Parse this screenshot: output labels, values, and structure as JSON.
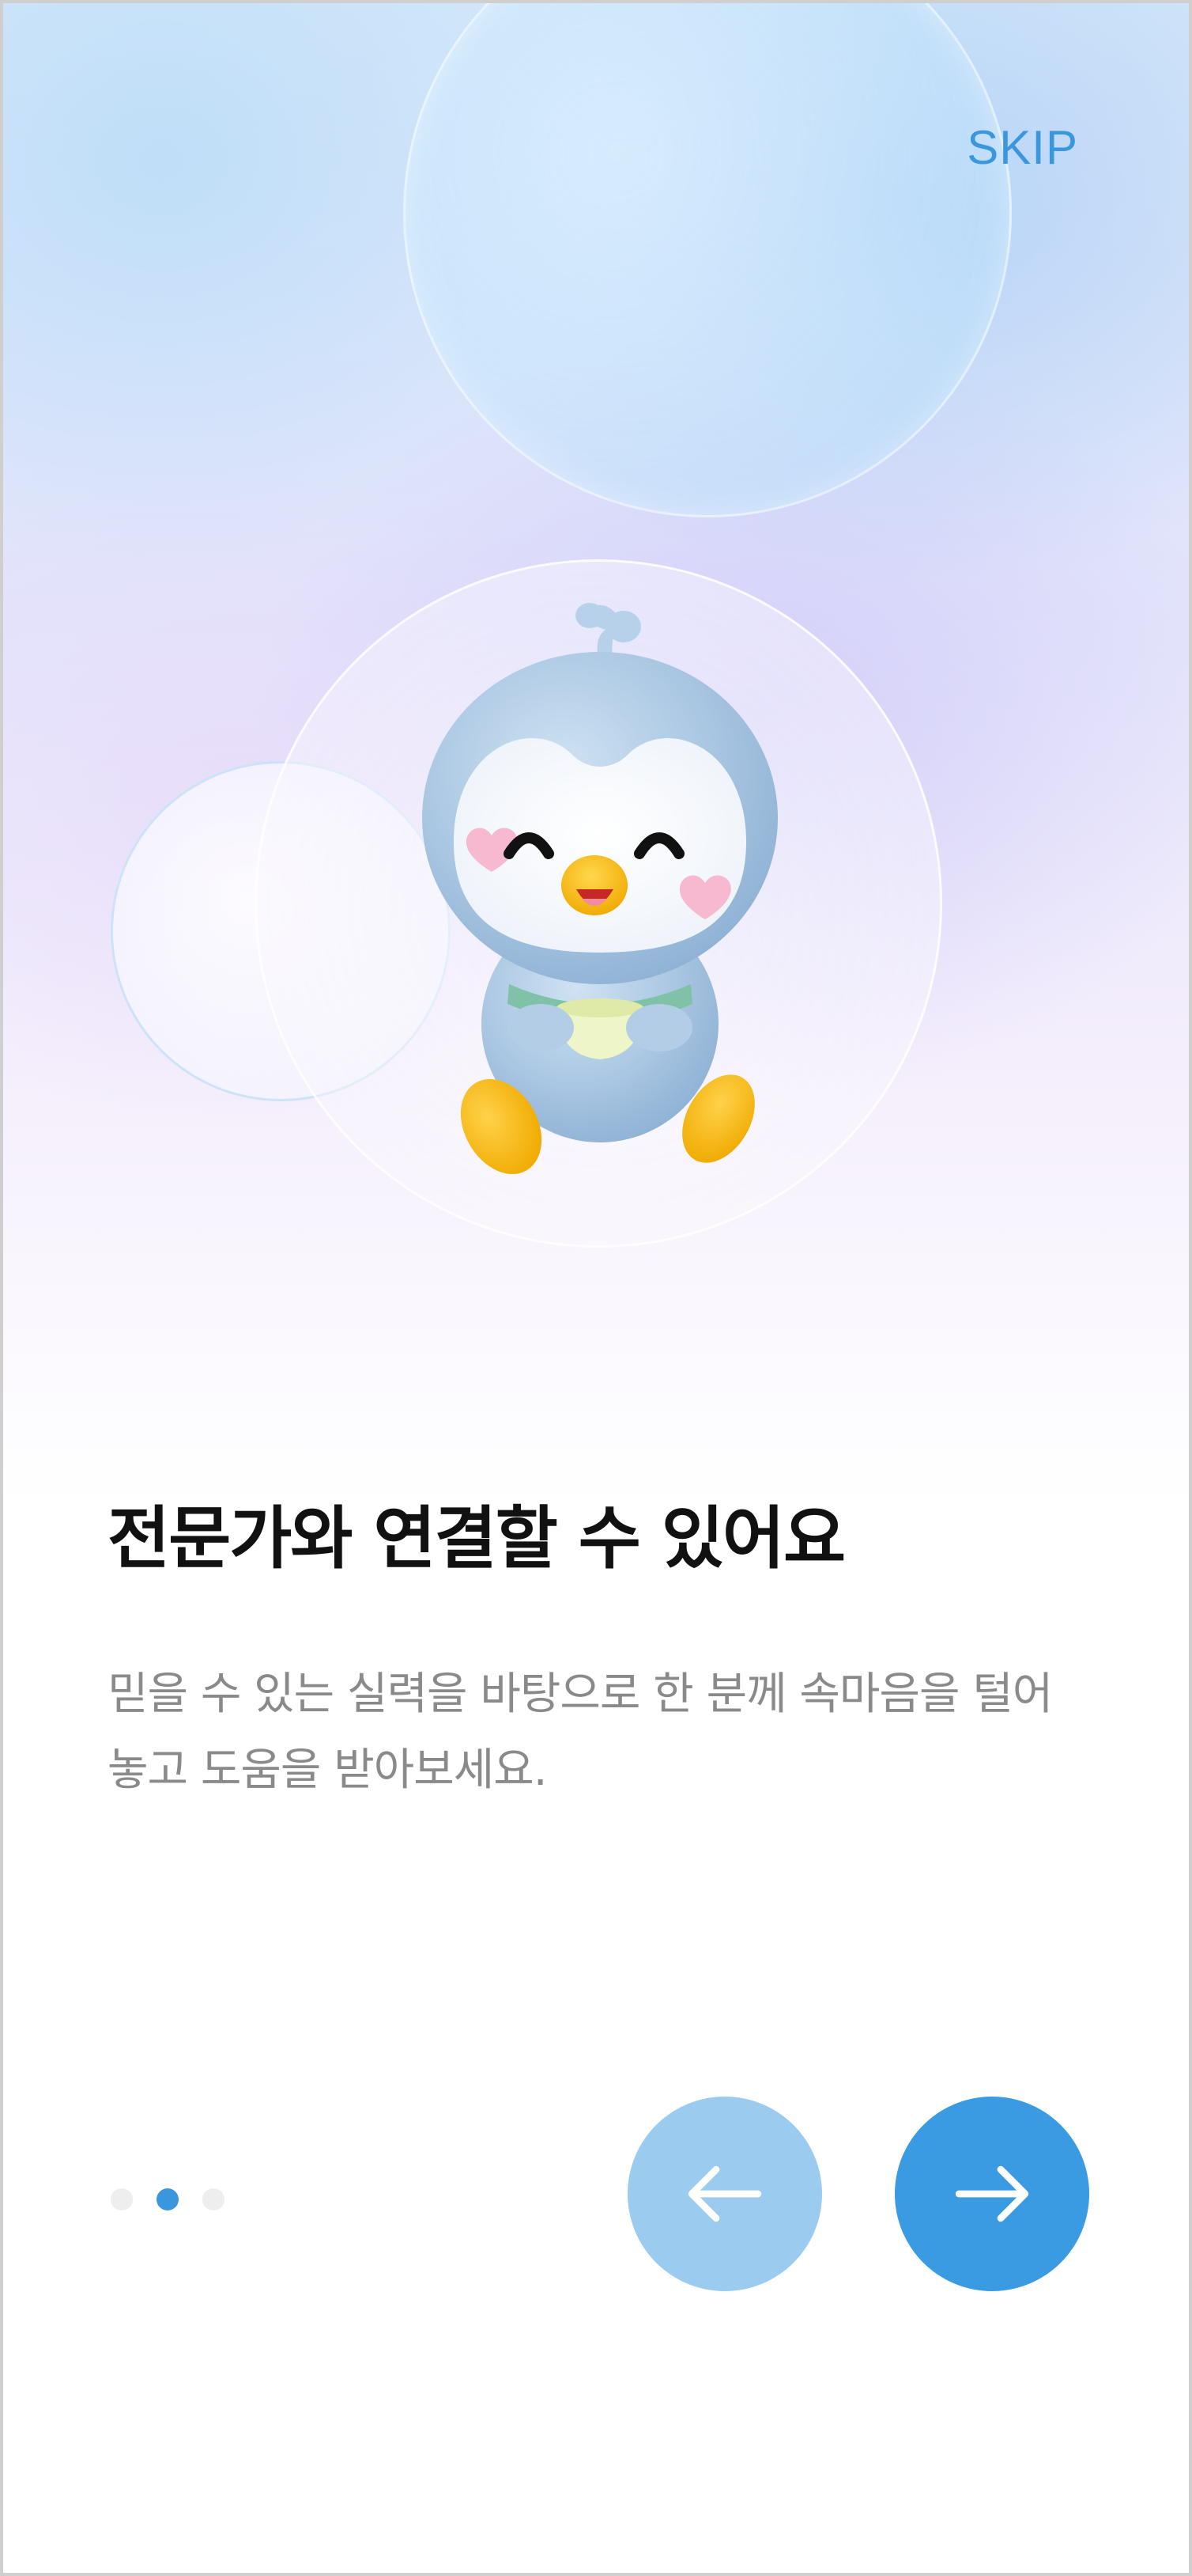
{
  "skip_label": "SKIP",
  "headline": "전문가와 연결할 수 있어요",
  "description": "믿을 수 있는 실력을 바탕으로 한 분께 속마음을 털어 놓고 도움을 받아보세요.",
  "pager": {
    "count": 3,
    "active_index": 1
  },
  "icons": {
    "prev": "arrow-left-icon",
    "next": "arrow-right-icon",
    "mascot": "penguin-mascot-illustration"
  },
  "colors": {
    "accent": "#3a97dd",
    "prev_button": "#9ccbf0",
    "next_button": "#3a9be2",
    "headline": "#111111",
    "description": "#8a8a8a",
    "dot_inactive": "#eeeeee"
  }
}
